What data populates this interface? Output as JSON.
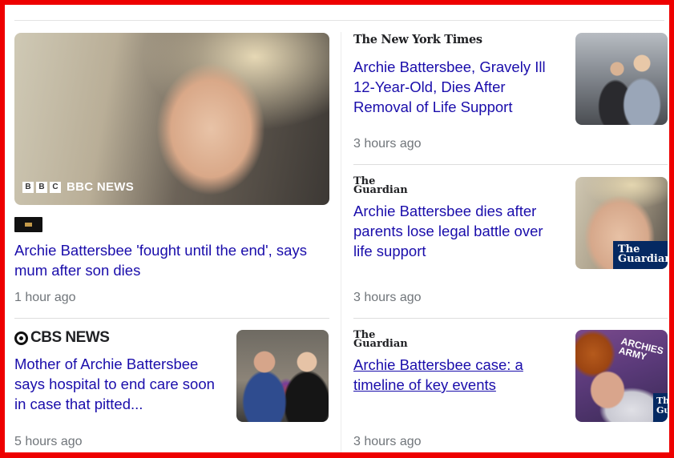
{
  "articles": [
    {
      "publisher": "BBC",
      "thumb_caption": "BBC NEWS",
      "headline": "Archie Battersbee 'fought until the end', says mum after son dies",
      "time": "1 hour ago"
    },
    {
      "publisher": "The New York Times",
      "headline": "Archie Battersbee, Gravely Ill 12-Year-Old, Dies After Removal of Life Support",
      "time": "3 hours ago"
    },
    {
      "publisher": "The Guardian",
      "thumb_caption": "The Guardian",
      "headline": "Archie Battersbee dies after parents lose legal battle over life support",
      "time": "3 hours ago"
    },
    {
      "publisher": "CBS NEWS",
      "headline": "Mother of Archie Battersbee says hospital to end care soon in case that pitted...",
      "time": "5 hours ago"
    },
    {
      "publisher": "The Guardian",
      "headline": "Archie Battersbee case: a timeline of key events",
      "time": "3 hours ago"
    }
  ],
  "colors": {
    "link": "#1a0dab",
    "meta": "#70757a",
    "frame": "#ee0000",
    "guardian_blue": "#052962"
  },
  "icons": {
    "bbc": "bbc-logo-icon",
    "cbs": "cbs-eye-icon"
  }
}
